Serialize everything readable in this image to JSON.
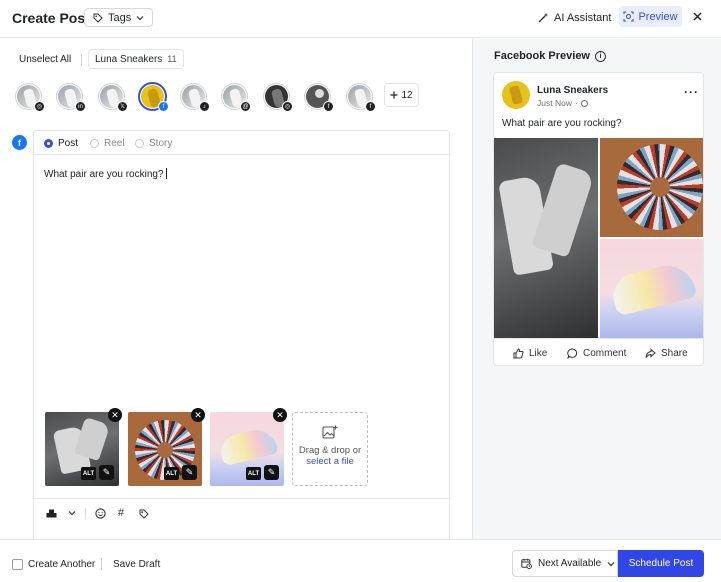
{
  "header": {
    "title": "Create Post",
    "tags_label": "Tags",
    "ai_label": "AI Assistant",
    "preview_label": "Preview",
    "close_icon": "close-icon"
  },
  "accounts": {
    "unselect_label": "Unselect All",
    "brand_name": "Luna Sneakers",
    "brand_count": "11",
    "profiles": [
      {
        "network": "instagram",
        "selected": false
      },
      {
        "network": "linkedin",
        "selected": false
      },
      {
        "network": "x",
        "selected": false
      },
      {
        "network": "facebook",
        "selected": true
      },
      {
        "network": "tiktok",
        "selected": false
      },
      {
        "network": "threads",
        "selected": false
      },
      {
        "network": "instagram",
        "selected": false
      },
      {
        "network": "facebook",
        "selected": false
      },
      {
        "network": "facebook",
        "selected": false
      }
    ],
    "more_label": "12"
  },
  "editor": {
    "types": [
      {
        "label": "Post",
        "selected": true
      },
      {
        "label": "Reel",
        "selected": false
      },
      {
        "label": "Story",
        "selected": false
      }
    ],
    "text": "What pair are you rocking?",
    "alt_label": "ALT",
    "dropzone_text": "Drag & drop or",
    "dropzone_link": "select a file"
  },
  "preview": {
    "title": "Facebook Preview",
    "page_name": "Luna Sneakers",
    "time": "Just Now",
    "text": "What pair are you rocking?",
    "actions": {
      "like": "Like",
      "comment": "Comment",
      "share": "Share"
    }
  },
  "footer": {
    "create_another": "Create Another",
    "save_draft": "Save Draft",
    "next_available": "Next Available",
    "schedule": "Schedule Post"
  },
  "colors": {
    "accent": "#3046e6",
    "preview_bg": "#e8eeff",
    "facebook": "#1877f2"
  }
}
